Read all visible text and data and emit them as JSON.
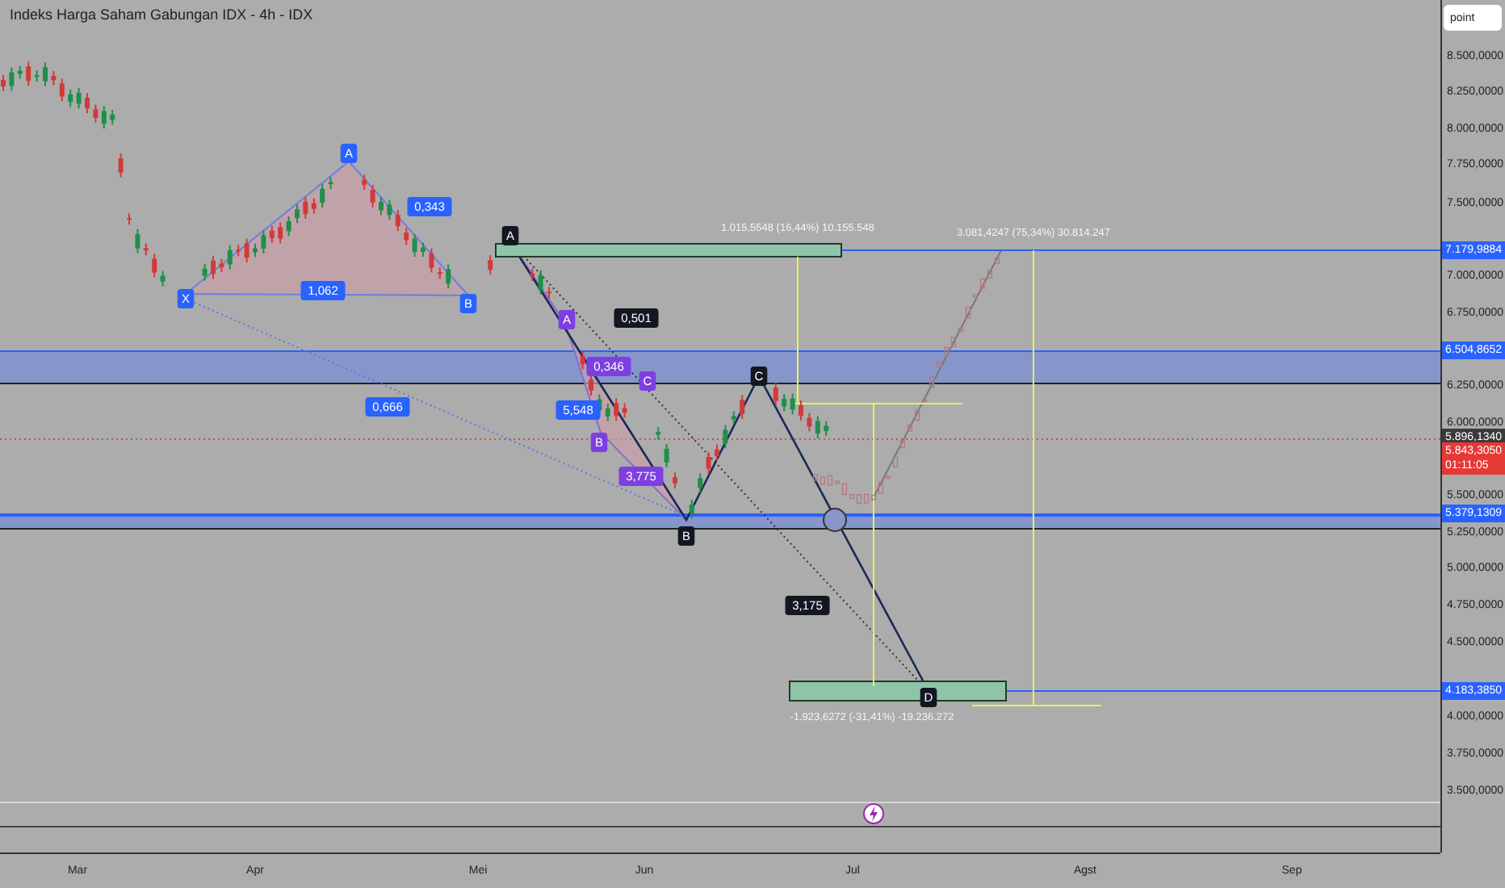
{
  "header": {
    "title": "Indeks Harga Saham Gabungan IDX - 4h - IDX"
  },
  "price_axis": {
    "scale_button": "point",
    "ticks": [
      "8.500,0000",
      "8.250,0000",
      "8.000,0000",
      "7.750,0000",
      "7.500,0000",
      "7.000,0000",
      "6.750,0000",
      "6.250,0000",
      "6.000,0000",
      "5.500,0000",
      "5.250,0000",
      "5.000,0000",
      "4.750,0000",
      "4.500,0000",
      "4.000,0000",
      "3.750,0000",
      "3.500,0000"
    ]
  },
  "price_tags": [
    {
      "kind": "level",
      "text": "7.179,9884"
    },
    {
      "kind": "level",
      "text": "6.504,8652"
    },
    {
      "kind": "last",
      "text": "5.896,1340"
    },
    {
      "kind": "live",
      "text": "5.843,3050",
      "countdown": "01:11:05"
    },
    {
      "kind": "level",
      "text": "5.379,1309"
    },
    {
      "kind": "level",
      "text": "4.183,3850"
    }
  ],
  "pattern_points": [
    {
      "text": "X",
      "color": "#2962ff"
    },
    {
      "text": "A",
      "color": "#2962ff"
    },
    {
      "text": "B",
      "color": "#2962ff"
    },
    {
      "text": "A",
      "color": "#7e3fe0"
    },
    {
      "text": "C",
      "color": "#7e3fe0"
    },
    {
      "text": "B",
      "color": "#7e3fe0"
    },
    {
      "text": "A",
      "color": "#131722"
    },
    {
      "text": "C",
      "color": "#131722"
    },
    {
      "text": "B",
      "color": "#131722"
    },
    {
      "text": "D",
      "color": "#131722"
    }
  ],
  "ratios": [
    {
      "text": "0,343",
      "color": "#2962ff"
    },
    {
      "text": "1,062",
      "color": "#2962ff"
    },
    {
      "text": "0,666",
      "color": "#2962ff"
    },
    {
      "text": "0,346",
      "color": "#7e3fe0"
    },
    {
      "text": "5,548",
      "color": "#2962ff"
    },
    {
      "text": "3,775",
      "color": "#7e3fe0"
    },
    {
      "text": "0,501",
      "color": "#131722"
    },
    {
      "text": "3,175",
      "color": "#131722"
    }
  ],
  "measurements": [
    "1.015,5548 (16,44%) 10.155.548",
    "3.081,4247 (75,34%) 30.814.247",
    "-1.923,6272 (-31,41%) -19.236.272"
  ],
  "time_axis": {
    "ticks": [
      "Mar",
      "Apr",
      "Mei",
      "Jun",
      "Jul",
      "Agst",
      "Sep"
    ]
  }
}
